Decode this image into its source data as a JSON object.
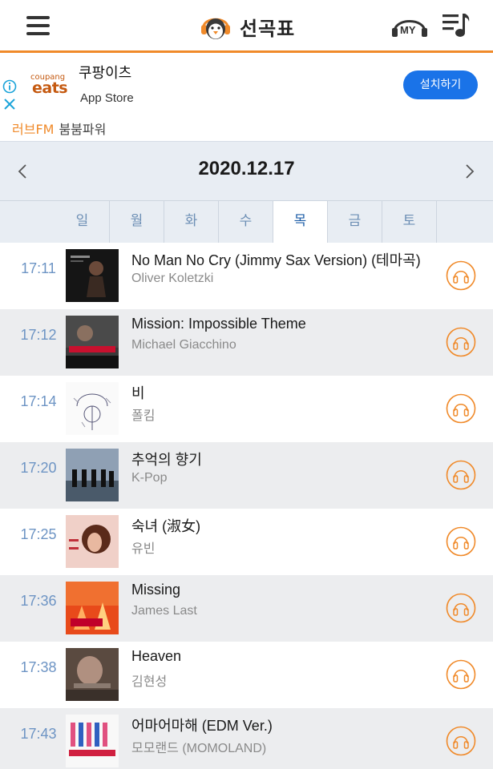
{
  "header": {
    "title": "선곡표",
    "my_label": "MY",
    "icons": {
      "menu": "hamburger-menu-icon",
      "logo": "penguin-headphones-icon",
      "my": "my-headphones-icon",
      "playlist": "playlist-music-icon"
    }
  },
  "ad": {
    "brand_small": "coupang",
    "brand_big": "eats",
    "title": "쿠팡이츠",
    "subtitle": "App Store",
    "install_label": "설치하기",
    "station": "러브FM",
    "program": "붐붐파워",
    "icons": {
      "info": "info-icon",
      "close": "close-icon"
    }
  },
  "date": {
    "label": "2020.12.17",
    "icons": {
      "prev": "chevron-left-icon",
      "next": "chevron-right-icon"
    }
  },
  "days": [
    "일",
    "월",
    "화",
    "수",
    "목",
    "금",
    "토"
  ],
  "active_day": "목",
  "songs": [
    {
      "time": "17:11",
      "title": "No Man No Cry (Jimmy Sax Version) (테마곡)",
      "artist": "Oliver Koletzki"
    },
    {
      "time": "17:12",
      "title": "Mission: Impossible Theme",
      "artist": "Michael Giacchino"
    },
    {
      "time": "17:14",
      "title": "비",
      "artist": "폴킴"
    },
    {
      "time": "17:20",
      "title": "추억의 향기",
      "artist": "K-Pop"
    },
    {
      "time": "17:25",
      "title": "숙녀 (淑女)",
      "artist": "유빈"
    },
    {
      "time": "17:36",
      "title": "Missing",
      "artist": "James Last"
    },
    {
      "time": "17:38",
      "title": "Heaven",
      "artist": "김현성"
    },
    {
      "time": "17:43",
      "title": "어마어마해 (EDM Ver.)",
      "artist": "모모랜드 (MOMOLAND)"
    }
  ],
  "colors": {
    "accent": "#f08a2a",
    "time_text": "#6d94c4",
    "install_button": "#1a73e8",
    "active_tab_text": "#1f5fa8",
    "inactive_tab_text": "#6d8fb5",
    "row_alt": "#ecedef"
  }
}
